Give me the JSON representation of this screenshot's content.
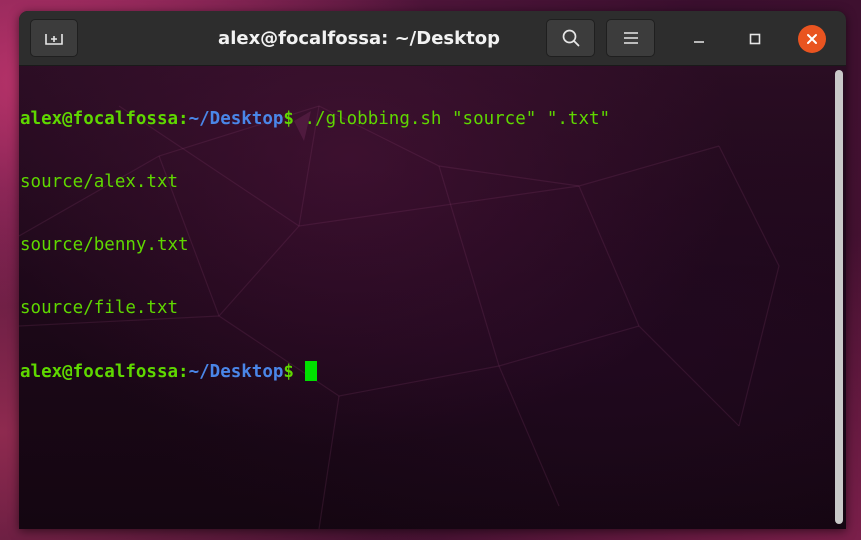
{
  "window": {
    "title": "alex@focalfossa: ~/Desktop"
  },
  "titlebar": {
    "new_tab_icon": "new-tab-icon",
    "search_icon": "search-icon",
    "menu_icon": "hamburger-menu-icon",
    "minimize_icon": "minimize-icon",
    "maximize_icon": "maximize-icon",
    "close_icon": "close-icon",
    "close_color": "#e95420"
  },
  "terminal": {
    "lines": [
      {
        "type": "prompt",
        "user_host": "alex@focalfossa",
        "sep": ":",
        "path": "~/Desktop",
        "symbol": "$",
        "command": " ./globbing.sh \"source\" \".txt\""
      },
      {
        "type": "output",
        "text": "source/alex.txt"
      },
      {
        "type": "output",
        "text": "source/benny.txt"
      },
      {
        "type": "output",
        "text": "source/file.txt"
      },
      {
        "type": "prompt",
        "user_host": "alex@focalfossa",
        "sep": ":",
        "path": "~/Desktop",
        "symbol": "$",
        "command": " "
      }
    ],
    "colors": {
      "user": "#5fd700",
      "path": "#4a86e8",
      "cursor": "#00e000"
    }
  }
}
